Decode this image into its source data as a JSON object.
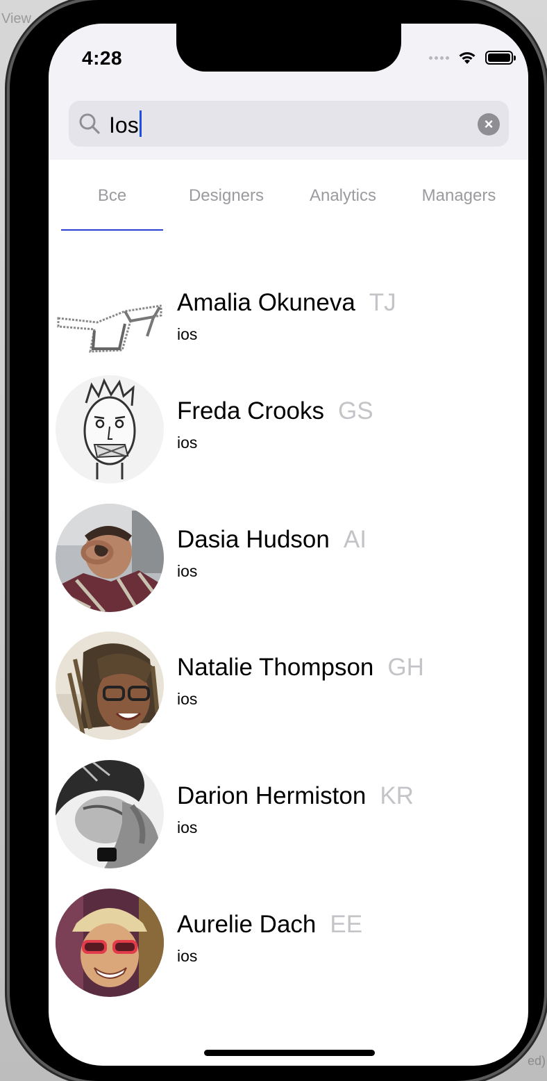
{
  "backdrop": {
    "left_text": "View",
    "right_text": "ed)"
  },
  "status_bar": {
    "time": "4:28"
  },
  "search": {
    "query": "Ios",
    "clear_symbol": "×"
  },
  "tabs": [
    {
      "label": "Все",
      "selected": true
    },
    {
      "label": "Designers",
      "selected": false
    },
    {
      "label": "Analytics",
      "selected": false
    },
    {
      "label": "Managers",
      "selected": false
    }
  ],
  "people": [
    {
      "name": "Amalia Okuneva",
      "initials": "TJ",
      "role": "ios",
      "avatar": "glasses-sketch"
    },
    {
      "name": "Freda Crooks",
      "initials": "GS",
      "role": "ios",
      "avatar": "sketch-face"
    },
    {
      "name": "Dasia Hudson",
      "initials": "AI",
      "role": "ios",
      "avatar": "photo-man-hand-eye"
    },
    {
      "name": "Natalie Thompson",
      "initials": "GH",
      "role": "ios",
      "avatar": "photo-woman-glasses"
    },
    {
      "name": "Darion Hermiston",
      "initials": "KR",
      "role": "ios",
      "avatar": "photo-man-bw"
    },
    {
      "name": "Aurelie Dach",
      "initials": "EE",
      "role": "ios",
      "avatar": "photo-man-red-glasses"
    }
  ],
  "colors": {
    "accent": "#2a3fd1",
    "initials": "#c4c4c8",
    "tab_inactive": "#9b9b9f",
    "search_bg": "#e4e4ea"
  }
}
